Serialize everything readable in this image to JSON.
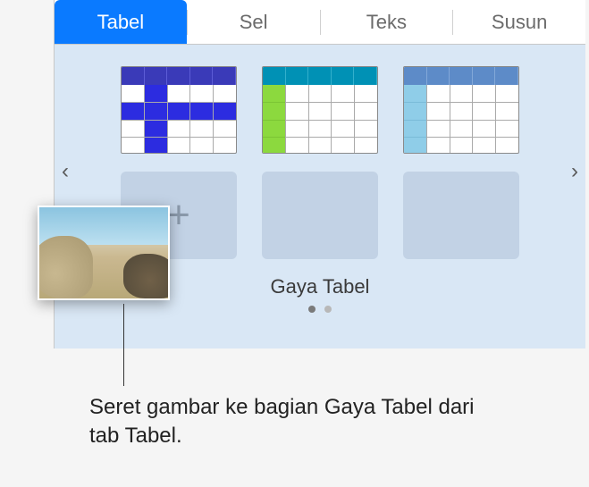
{
  "tabs": {
    "tabel": "Tabel",
    "sel": "Sel",
    "teks": "Teks",
    "susun": "Susun"
  },
  "panel": {
    "section_title": "Gaya Tabel",
    "nav_left": "‹",
    "nav_right": "›",
    "plus": "+"
  },
  "callout": {
    "text": "Seret gambar ke bagian Gaya Tabel dari tab Tabel."
  }
}
